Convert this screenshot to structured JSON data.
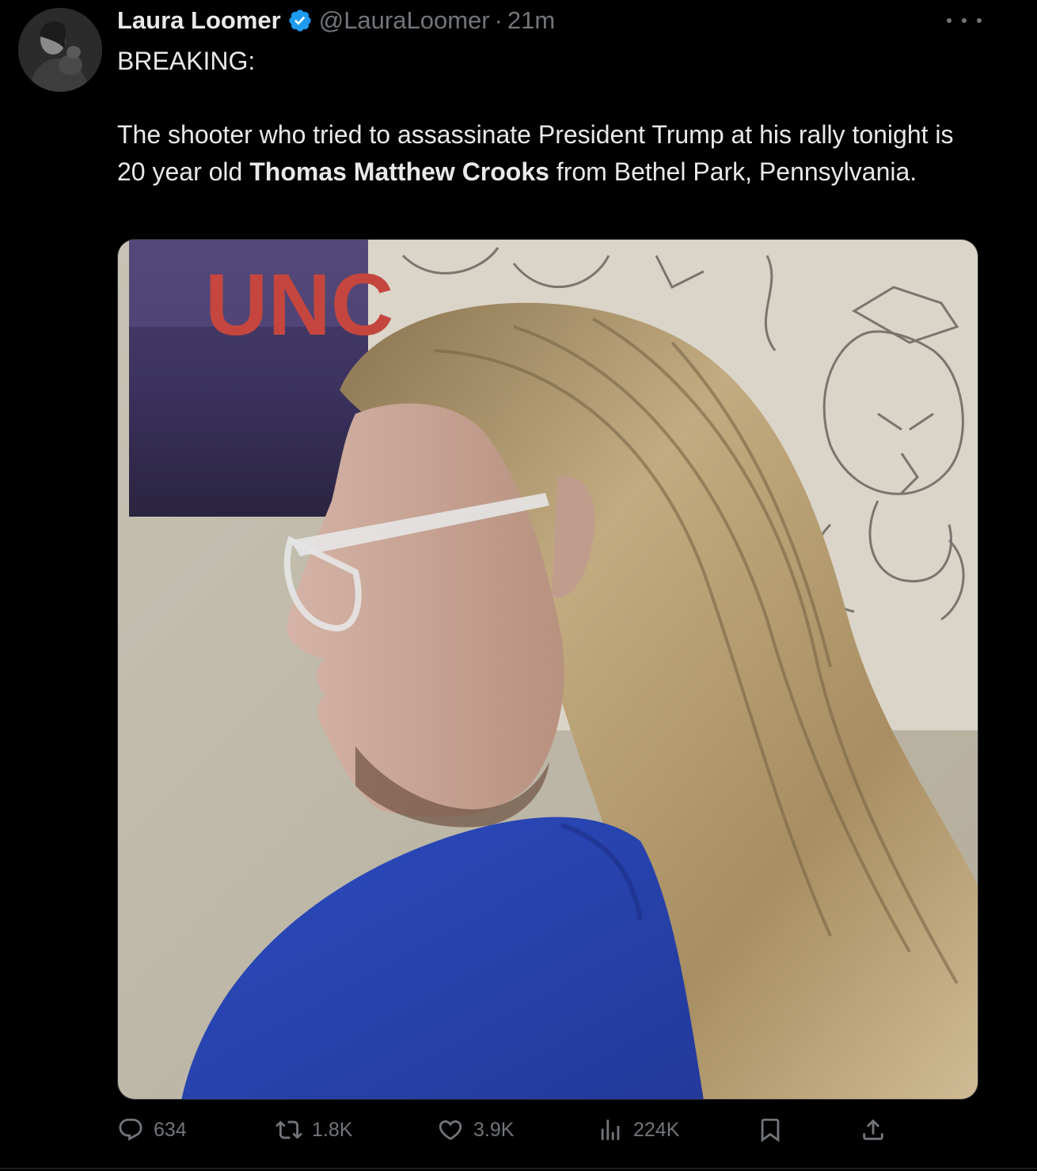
{
  "author": {
    "display_name": "Laura Loomer",
    "handle": "@LauraLoomer",
    "separator": "·",
    "time": "21m"
  },
  "tweet": {
    "line_1": "BREAKING:",
    "body_before": "The shooter who tried to assassinate President Trump at his rally tonight is 20 year old ",
    "body_bold": "Thomas Matthew Crooks",
    "body_after": " from Bethel Park, Pennsylvania."
  },
  "media": {
    "poster_text": "UNC"
  },
  "actions": {
    "replies": "634",
    "reposts": "1.8K",
    "likes": "3.9K",
    "views": "224K"
  },
  "icons": {
    "verified": "verified-badge-icon",
    "more": "more-dots-icon",
    "reply": "reply-icon",
    "repost": "repost-icon",
    "like": "heart-icon",
    "views": "views-chart-icon",
    "bookmark": "bookmark-icon",
    "share": "share-icon"
  },
  "colors": {
    "background": "#000000",
    "primary_text": "#e7e9ea",
    "secondary_text": "#71767b",
    "verified_blue": "#1d9bf0",
    "shirt_blue": "#2f4fb8",
    "hair": "#b59d72"
  }
}
